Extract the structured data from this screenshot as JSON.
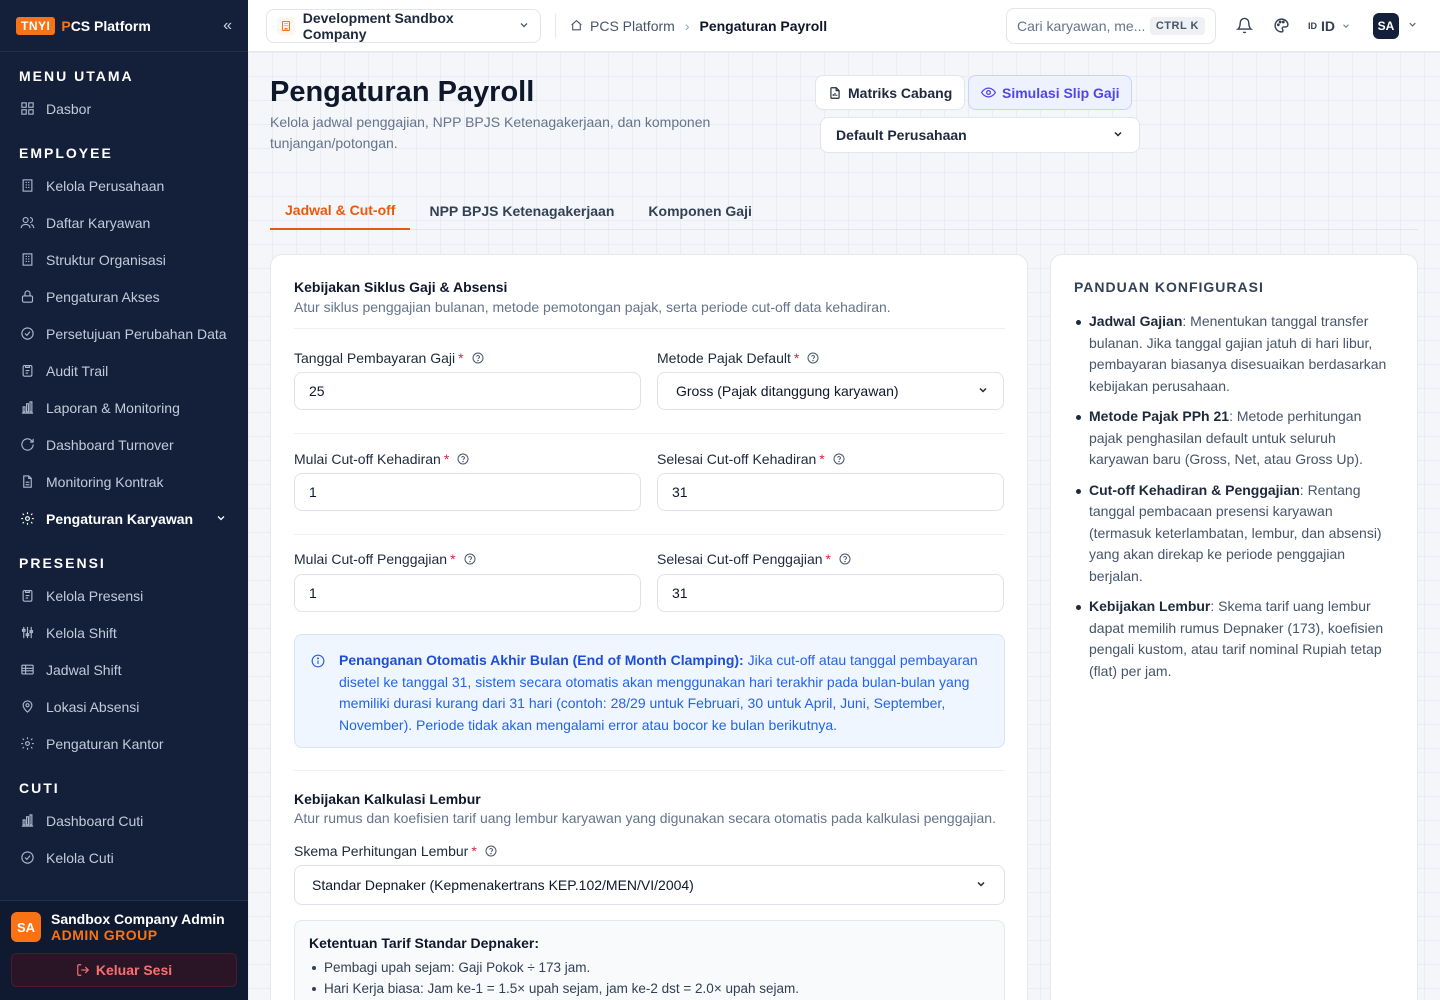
{
  "app": {
    "badge": "TNYI",
    "brand_p": "P",
    "brand_rest": "CS Platform"
  },
  "sidebar": {
    "sections": [
      {
        "title": "MENU UTAMA",
        "items": [
          {
            "label": "Dasbor",
            "icon": "grid-icon"
          }
        ]
      },
      {
        "title": "EMPLOYEE",
        "items": [
          {
            "label": "Kelola Perusahaan",
            "icon": "building-icon"
          },
          {
            "label": "Daftar Karyawan",
            "icon": "users-icon"
          },
          {
            "label": "Struktur Organisasi",
            "icon": "building-icon"
          },
          {
            "label": "Pengaturan Akses",
            "icon": "lock-icon"
          },
          {
            "label": "Persetujuan Perubahan Data",
            "icon": "check-circle-icon"
          },
          {
            "label": "Audit Trail",
            "icon": "clipboard-icon"
          },
          {
            "label": "Laporan & Monitoring",
            "icon": "bar-chart-icon"
          },
          {
            "label": "Dashboard Turnover",
            "icon": "refresh-icon"
          },
          {
            "label": "Monitoring Kontrak",
            "icon": "file-icon"
          },
          {
            "label": "Pengaturan Karyawan",
            "icon": "gear-icon",
            "active": true
          }
        ]
      },
      {
        "title": "PRESENSI",
        "items": [
          {
            "label": "Kelola Presensi",
            "icon": "clipboard-icon"
          },
          {
            "label": "Kelola Shift",
            "icon": "sliders-icon"
          },
          {
            "label": "Jadwal Shift",
            "icon": "table-icon"
          },
          {
            "label": "Lokasi Absensi",
            "icon": "map-pin-icon"
          },
          {
            "label": "Pengaturan Kantor",
            "icon": "gear-icon"
          }
        ]
      },
      {
        "title": "CUTI",
        "items": [
          {
            "label": "Dashboard Cuti",
            "icon": "bar-chart-icon"
          },
          {
            "label": "Kelola Cuti",
            "icon": "check-circle-icon"
          }
        ]
      }
    ],
    "user": {
      "initials": "SA",
      "name": "Sandbox Company Admin",
      "role": "ADMIN GROUP"
    },
    "logout_label": "Keluar Sesi"
  },
  "topbar": {
    "company": "Development Sandbox Company",
    "breadcrumb": [
      "PCS Platform",
      "Pengaturan Payroll"
    ],
    "search_placeholder": "Cari karyawan, me...",
    "shortcut": "CTRL K",
    "lang_flag": "ID",
    "lang": "ID",
    "avatar": "SA"
  },
  "page": {
    "title": "Pengaturan Payroll",
    "subtitle": "Kelola jadwal penggajian, NPP BPJS Ketenagakerjaan, dan komponen tunjangan/potongan.",
    "btn_matrix": "Matriks Cabang",
    "btn_sim": "Simulasi Slip Gaji",
    "branch": "Default Perusahaan",
    "tabs": [
      "Jadwal & Cut-off",
      "NPP BPJS Ketenagakerjaan",
      "Komponen Gaji"
    ]
  },
  "form": {
    "cycle_title": "Kebijakan Siklus Gaji & Absensi",
    "cycle_sub": "Atur siklus penggajian bulanan, metode pemotongan pajak, serta periode cut-off data kehadiran.",
    "pay_date_label": "Tanggal Pembayaran Gaji",
    "pay_date": "25",
    "tax_label": "Metode Pajak Default",
    "tax": "Gross (Pajak ditanggung karyawan)",
    "att_start_label": "Mulai Cut-off Kehadiran",
    "att_start": "1",
    "att_end_label": "Selesai Cut-off Kehadiran",
    "att_end": "31",
    "pay_start_label": "Mulai Cut-off Penggajian",
    "pay_start": "1",
    "pay_end_label": "Selesai Cut-off Penggajian",
    "pay_end": "31",
    "info_bold": "Penanganan Otomatis Akhir Bulan (End of Month Clamping):",
    "info_text": " Jika cut-off atau tanggal pembayaran disetel ke tanggal 31, sistem secara otomatis akan menggunakan hari terakhir pada bulan-bulan yang memiliki durasi kurang dari 31 hari (contoh: 28/29 untuk Februari, 30 untuk April, Juni, September, November). Periode tidak akan mengalami error atau bocor ke bulan berikutnya.",
    "ot_title": "Kebijakan Kalkulasi Lembur",
    "ot_sub": "Atur rumus dan koefisien tarif uang lembur karyawan yang digunakan secara otomatis pada kalkulasi penggajian.",
    "ot_label": "Skema Perhitungan Lembur",
    "ot_scheme": "Standar Depnaker (Kepmenakertrans KEP.102/MEN/VI/2004)",
    "rules_title": "Ketentuan Tarif Standar Depnaker:",
    "rules": [
      "Pembagi upah sejam: Gaji Pokok ÷ 173 jam.",
      "Hari Kerja biasa: Jam ke-1 = 1.5× upah sejam, jam ke-2 dst = 2.0× upah sejam."
    ]
  },
  "guide": {
    "title": "PANDUAN KONFIGURASI",
    "items": [
      {
        "term": "Jadwal Gajian",
        "text": ": Menentukan tanggal transfer bulanan. Jika tanggal gajian jatuh di hari libur, pembayaran biasanya disesuaikan berdasarkan kebijakan perusahaan."
      },
      {
        "term": "Metode Pajak PPh 21",
        "text": ": Metode perhitungan pajak penghasilan default untuk seluruh karyawan baru (Gross, Net, atau Gross Up)."
      },
      {
        "term": "Cut-off Kehadiran & Penggajian",
        "text": ": Rentang tanggal pembacaan presensi karyawan (termasuk keterlambatan, lembur, dan absensi) yang akan direkap ke periode penggajian berjalan."
      },
      {
        "term": "Kebijakan Lembur",
        "text": ": Skema tarif uang lembur dapat memilih rumus Depnaker (173), koefisien pengali kustom, atau tarif nominal Rupiah tetap (flat) per jam."
      }
    ]
  }
}
